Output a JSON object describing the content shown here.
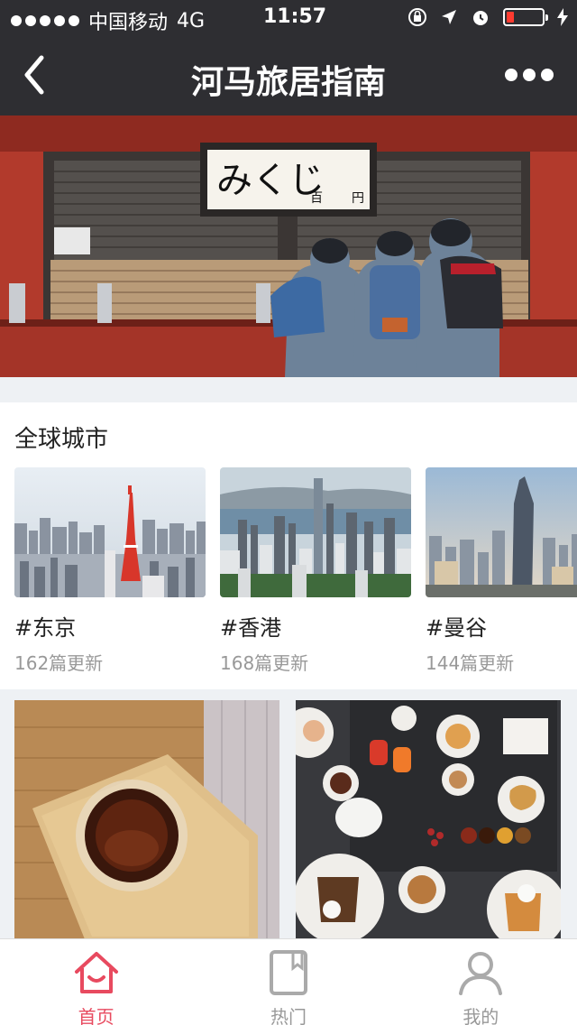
{
  "status_bar": {
    "carrier": "中国移动",
    "network": "4G",
    "time": "11:57"
  },
  "nav": {
    "title": "河马旅居指南"
  },
  "hero": {
    "sign_text": "みくじ",
    "sign_small_left": "百",
    "sign_small_right": "円"
  },
  "section": {
    "title": "全球城市"
  },
  "cities": [
    {
      "name": "#东京",
      "count": "162篇更新"
    },
    {
      "name": "#香港",
      "count": "168篇更新"
    },
    {
      "name": "#曼谷",
      "count": "144篇更新"
    }
  ],
  "tabs": [
    {
      "label": "首页",
      "icon": "home-icon"
    },
    {
      "label": "热门",
      "icon": "bookmark-icon"
    },
    {
      "label": "我的",
      "icon": "user-icon"
    }
  ],
  "colors": {
    "accent": "#e84a5f",
    "navbar": "#2e2e32"
  }
}
